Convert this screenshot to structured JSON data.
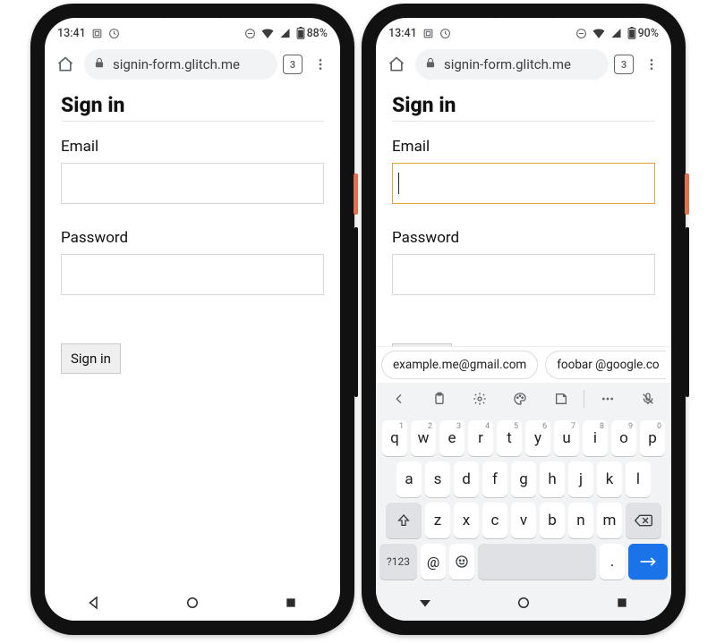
{
  "status": {
    "time": "13:41",
    "battery_left": "88%",
    "battery_right": "90%"
  },
  "browser": {
    "url": "signin-form.glitch.me",
    "tab_count": "3"
  },
  "page": {
    "heading": "Sign in",
    "email_label": "Email",
    "password_label": "Password",
    "submit_label": "Sign in"
  },
  "autofill": {
    "suggestion1": "example.me@gmail.com",
    "suggestion2": "foobar @google.co"
  },
  "keyboard": {
    "row1": [
      {
        "k": "q",
        "n": "1"
      },
      {
        "k": "w",
        "n": "2"
      },
      {
        "k": "e",
        "n": "3"
      },
      {
        "k": "r",
        "n": "4"
      },
      {
        "k": "t",
        "n": "5"
      },
      {
        "k": "y",
        "n": "6"
      },
      {
        "k": "u",
        "n": "7"
      },
      {
        "k": "i",
        "n": "8"
      },
      {
        "k": "o",
        "n": "9"
      },
      {
        "k": "p",
        "n": "0"
      }
    ],
    "row2": [
      "a",
      "s",
      "d",
      "f",
      "g",
      "h",
      "j",
      "k",
      "l"
    ],
    "row3": [
      "z",
      "x",
      "c",
      "v",
      "b",
      "n",
      "m"
    ],
    "sym_label": "?123",
    "at_label": "@",
    "dot_label": "."
  }
}
